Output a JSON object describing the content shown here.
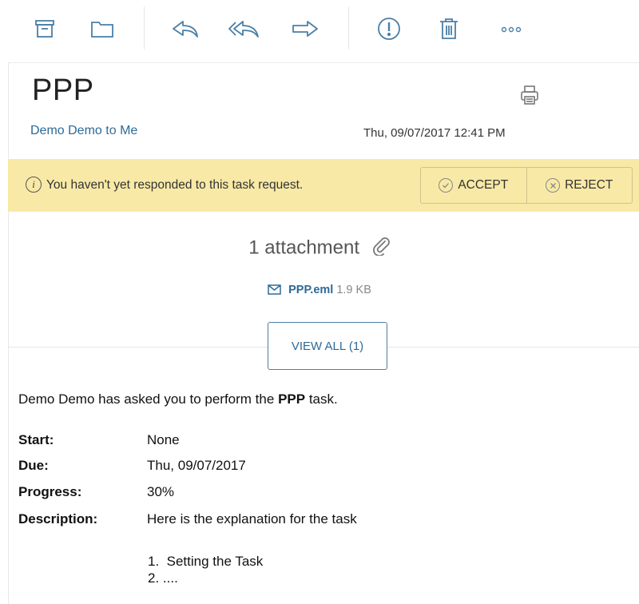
{
  "toolbar": {
    "archive_icon": "archive-icon",
    "folder_icon": "folder-icon",
    "reply_icon": "reply-icon",
    "reply_all_icon": "reply-all-icon",
    "forward_icon": "forward-icon",
    "important_icon": "exclamation-icon",
    "delete_icon": "trash-icon",
    "more_icon": "more-icon"
  },
  "message": {
    "subject": "PPP",
    "from": "Demo Demo",
    "to_word": "to",
    "to": "Me",
    "date": "Thu, 09/07/2017 12:41 PM"
  },
  "banner": {
    "info_glyph": "i",
    "text": "You haven't yet responded to this task request.",
    "accept_label": "ACCEPT",
    "reject_label": "REJECT",
    "background": "#f8e9a6"
  },
  "attachments": {
    "title": "1 attachment",
    "file_name": "PPP.eml",
    "file_size": "1.9 KB",
    "view_all_label": "VIEW ALL (1)"
  },
  "body": {
    "intro_prefix": "Demo Demo has asked you to perform the",
    "intro_task": "PPP",
    "intro_suffix": "task.",
    "fields": [
      {
        "label": "Start:",
        "value": "None"
      },
      {
        "label": "Due:",
        "value": "Thu, 09/07/2017"
      },
      {
        "label": "Progress:",
        "value": "30%"
      },
      {
        "label": "Description:",
        "value": "Here is the explanation for the task"
      }
    ],
    "list": [
      "1.  Setting the Task",
      "2. ...."
    ]
  },
  "colors": {
    "link": "#2c6a97",
    "icon": "#4b7fa6"
  }
}
